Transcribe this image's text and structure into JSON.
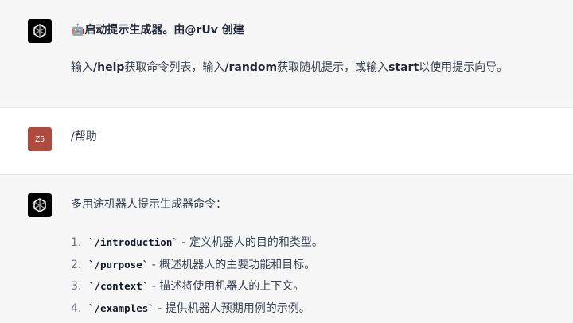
{
  "messages": {
    "intro": {
      "title_emoji": "🤖",
      "title": "启动提示生成器。由@rUv 创建",
      "body_prefix": "输入",
      "help_cmd": "/help",
      "body_mid1": "获取命令列表，输入",
      "random_cmd": "/random",
      "body_mid2": "获取随机提示，或输入",
      "start_cmd": "start",
      "body_suffix": "以使用提示向导。"
    },
    "user": {
      "avatar_text": "Z5",
      "text": "/帮助"
    },
    "reply": {
      "heading": "多用途机器人提示生成器命令：",
      "items": [
        {
          "num": "1.",
          "cmd": "`/introduction`",
          "desc": " - 定义机器人的目的和类型。"
        },
        {
          "num": "2.",
          "cmd": "`/purpose`",
          "desc": " - 概述机器人的主要功能和目标。"
        },
        {
          "num": "3.",
          "cmd": "`/context`",
          "desc": " - 描述将使用机器人的上下文。"
        },
        {
          "num": "4.",
          "cmd": "`/examples`",
          "desc": " - 提供机器人预期用例的示例。"
        }
      ]
    }
  },
  "icons": {
    "bot_avatar": "openai-logo-icon"
  },
  "colors": {
    "bot_bg": "#f7f7f8",
    "user_avatar_bg": "#b04a3e"
  }
}
